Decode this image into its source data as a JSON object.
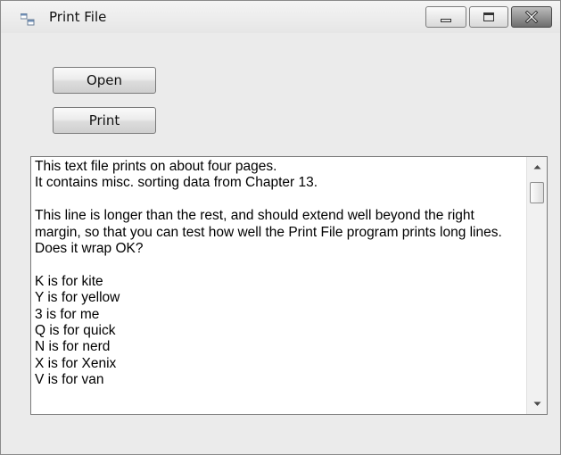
{
  "window": {
    "title": "Print File",
    "icon": "app-window-icon"
  },
  "toolbar": {
    "open_label": "Open",
    "print_label": "Print"
  },
  "content": {
    "text": "This text file prints on about four pages.\nIt contains misc. sorting data from Chapter 13.\n\nThis line is longer than the rest, and should extend well beyond the right margin, so that you can test how well the Print File program prints long lines.  Does it wrap OK?\n\nK is for kite\nY is for yellow\n3 is for me\nQ is for quick\nN is for nerd\nX is for Xenix\nV is for van"
  },
  "colors": {
    "client_background": "#ebebeb",
    "textbox_background": "#ffffff"
  }
}
